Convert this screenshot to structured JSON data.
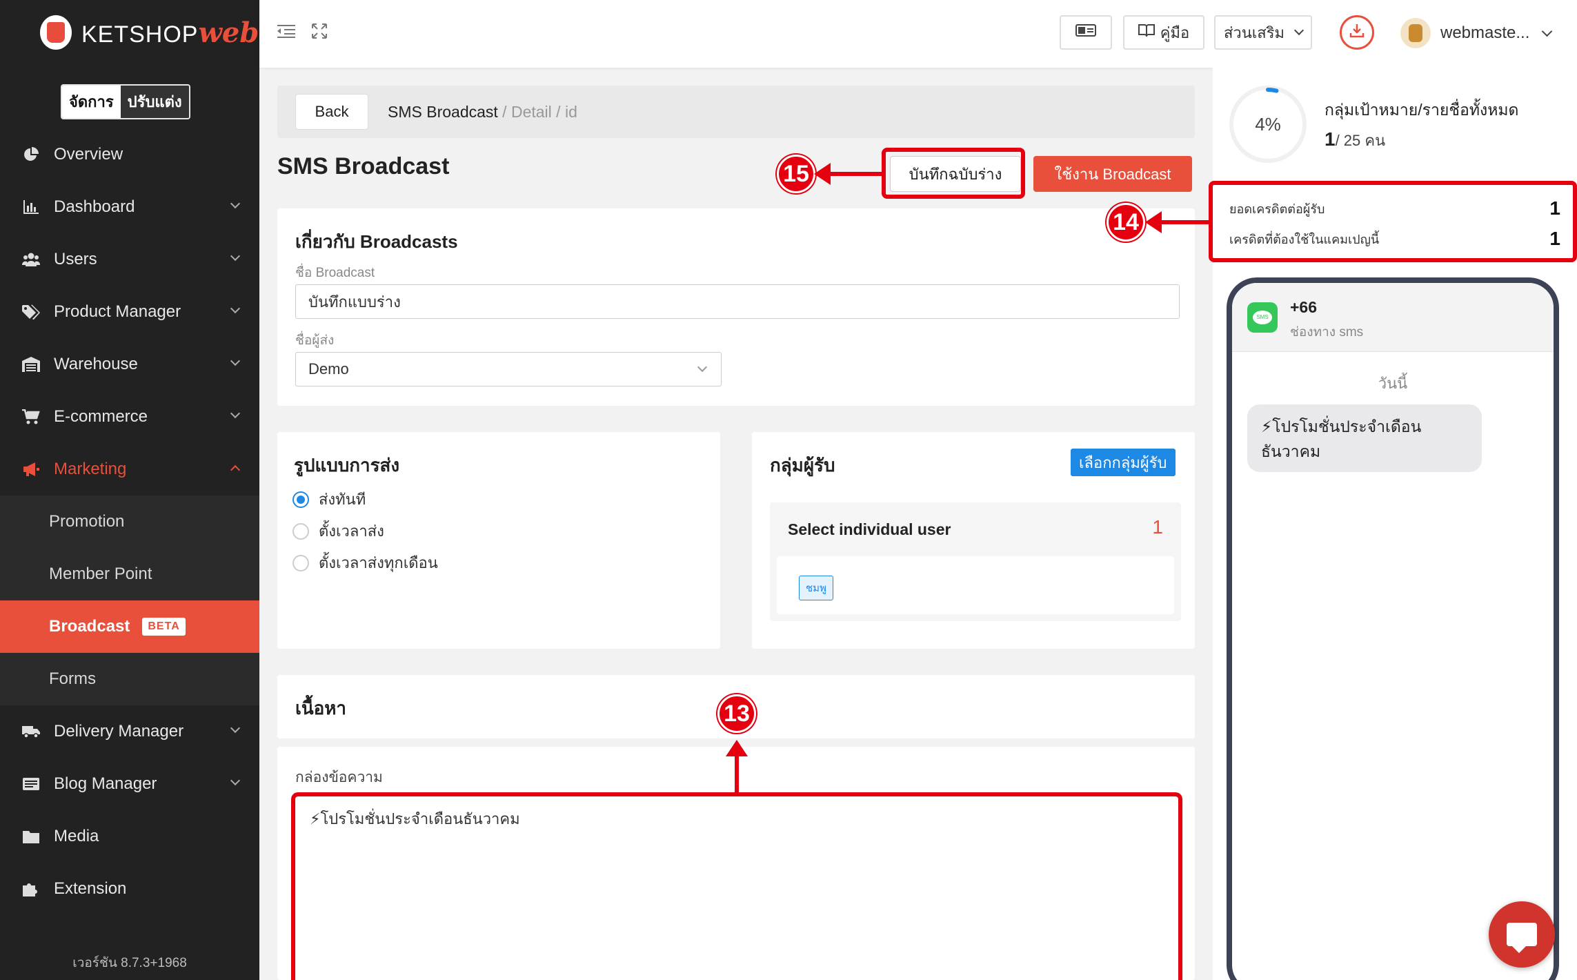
{
  "sidebar": {
    "logo_text": "KETSHOP",
    "logo_web": "web",
    "mode_active": "จัดการ",
    "mode_inactive": "ปรับแต่ง",
    "items": [
      {
        "label": "Overview",
        "icon": "pie-chart-icon"
      },
      {
        "label": "Dashboard",
        "icon": "bar-chart-icon"
      },
      {
        "label": "Users",
        "icon": "users-icon"
      },
      {
        "label": "Product Manager",
        "icon": "tag-icon"
      },
      {
        "label": "Warehouse",
        "icon": "warehouse-icon"
      },
      {
        "label": "E-commerce",
        "icon": "cart-icon"
      },
      {
        "label": "Marketing",
        "icon": "megaphone-icon"
      }
    ],
    "submenu": [
      {
        "label": "Promotion"
      },
      {
        "label": "Member Point"
      },
      {
        "label": "Broadcast",
        "badge": "BETA"
      },
      {
        "label": "Forms"
      }
    ],
    "items_after": [
      {
        "label": "Delivery Manager",
        "icon": "truck-icon"
      },
      {
        "label": "Blog Manager",
        "icon": "blog-icon"
      },
      {
        "label": "Media",
        "icon": "folder-icon"
      },
      {
        "label": "Extension",
        "icon": "puzzle-icon"
      }
    ],
    "version": "เวอร์ชัน 8.7.3+1968"
  },
  "topbar": {
    "manual_label": "คู่มือ",
    "addons_label": "ส่วนเสริม",
    "username": "webmaste..."
  },
  "breadcrumb": {
    "back_label": "Back",
    "current": "SMS Broadcast",
    "sep1": " / ",
    "detail": "Detail",
    "sep2": " / ",
    "id": "id"
  },
  "page": {
    "title": "SMS Broadcast",
    "draft_button": "บันทึกฉบับร่าง",
    "use_button": "ใช้งาน Broadcast"
  },
  "about": {
    "heading": "เกี่ยวกับ Broadcasts",
    "name_label": "ชื่อ Broadcast",
    "name_value": "บันทึกแบบร่าง",
    "sender_label": "ชื่อผู้ส่ง",
    "sender_value": "Demo"
  },
  "send_type": {
    "heading": "รูปแบบการส่ง",
    "options": [
      "ส่งทันที",
      "ตั้งเวลาส่ง",
      "ตั้งเวลาส่งทุกเดือน"
    ],
    "selected_index": 0
  },
  "recipients": {
    "heading": "กลุ่มผู้รับ",
    "choose_button": "เลือกกลุ่มผู้รับ",
    "mode_title": "Select individual user",
    "count": "1",
    "tag": "ชมพู"
  },
  "content": {
    "heading": "เนื้อหา",
    "message_label": "กล่องข้อความ",
    "message_value": "⚡โปรโมชั่นประจำเดือนธันวาคม"
  },
  "summary": {
    "percent": "4%",
    "percent_value": 0.04,
    "group_title": "กลุ่มเป้าหมาย/รายชื่อทั้งหมด",
    "selected": "1",
    "total": "/ 25 คน",
    "credit_per_recipient_label": "ยอดเครดิตต่อผู้รับ",
    "credit_per_recipient": "1",
    "campaign_credit_label": "เครดิตที่ต้องใช้ในแคมเปญนี้",
    "campaign_credit": "1"
  },
  "preview": {
    "number": "+66",
    "channel": "ช่องทาง sms",
    "today": "วันนี้",
    "bubble_line1": "⚡โปรโมชั่นประจำเดือน",
    "bubble_line2": "ธันวาคม"
  },
  "annotations": {
    "n13": "13",
    "n14": "14",
    "n15": "15",
    "color": "#e4000f"
  },
  "colors": {
    "accent": "#e8503b",
    "primary": "#1e88e5",
    "sidebar_bg": "#222222"
  }
}
